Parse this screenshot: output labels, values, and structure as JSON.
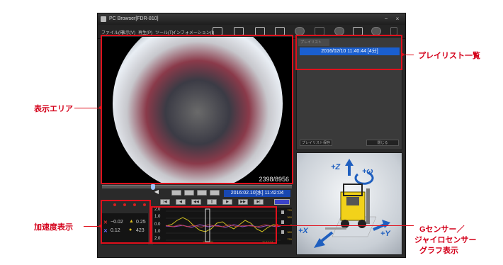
{
  "window": {
    "title": "PC Browser[FDR-810]",
    "controls": {
      "minimize": "−",
      "close": "×"
    }
  },
  "menu": [
    {
      "label": "ファイル(F)"
    },
    {
      "label": "表示(V)"
    },
    {
      "label": "再生(P)"
    },
    {
      "label": "ツール(T)"
    },
    {
      "label": "インフォメーション(I)"
    }
  ],
  "toolbar": {
    "icons": [
      "open-folder-icon",
      "print-icon",
      "camera-icon",
      "export-icon",
      "zoom-icon",
      "save-icon",
      "disc-icon",
      "graph-icon",
      "settings-icon",
      "help-icon"
    ]
  },
  "video": {
    "frame_counter": "2398/8956",
    "seek_position": 0.27
  },
  "playlist": {
    "tab_label": "プレイリスト",
    "items": [
      {
        "label": "2016/02/10 11:40:44 [4分]"
      }
    ],
    "left_button": "プレイリスト保存",
    "close_button": "閉じる"
  },
  "gyro": {
    "z_label": "+Z",
    "omega_label": "+ω",
    "x_label": "+X",
    "y_label": "+Y"
  },
  "playback": {
    "datetime": "2016:02.10[水] 11:42:04"
  },
  "accel": {
    "leds": 4,
    "x_value": "−0.02",
    "y_value": "0.12",
    "z_value": "0.25",
    "omega_value": "423"
  },
  "graph": {
    "y_ticks": [
      "2.0",
      "1.0",
      "0.0",
      "1.0",
      "2.0"
    ],
    "right_ticks": [
      "720",
      "360",
      "0",
      "360",
      "720"
    ],
    "time_labels": [
      "11:42:04",
      "11:42:14"
    ]
  },
  "callouts": {
    "playlist": "プレイリスト一覧",
    "display": "表示エリア",
    "accel": "加速度表示",
    "gsensor_line1": "Gセンサー／",
    "gsensor_line2": "ジャイロセンサー",
    "gsensor_line3": "グラフ表示"
  },
  "colors": {
    "callout": "#e0101c",
    "selection": "#1a5fd0",
    "datetime_bg": "#1847b0",
    "axis_blue": "#1f5fbf"
  }
}
